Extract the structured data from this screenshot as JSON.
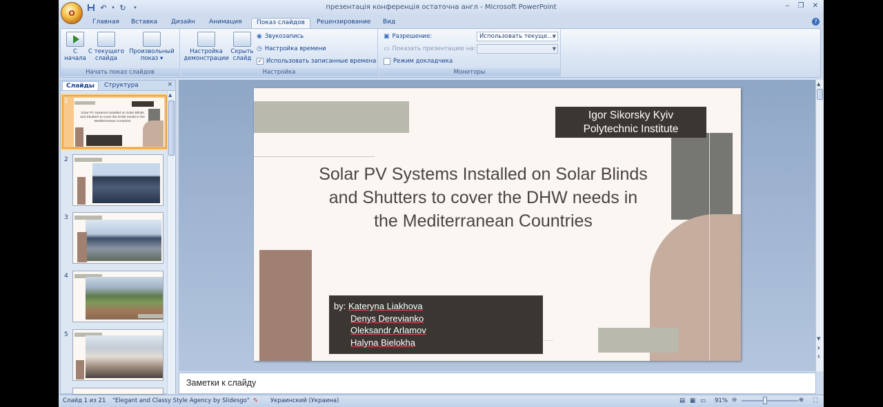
{
  "window": {
    "title": "презентація конференція остаточна  англ - Microsoft PowerPoint",
    "office_button": "O"
  },
  "tabs": [
    "Главная",
    "Вставка",
    "Дизайн",
    "Анимация",
    "Показ слайдов",
    "Рецензирование",
    "Вид"
  ],
  "ribbon": {
    "group1": {
      "label": "Начать показ слайдов",
      "from_start": [
        "С",
        "начала"
      ],
      "from_current": [
        "С текущего",
        "слайда"
      ],
      "custom": [
        "Произвольный",
        "показ ▾"
      ]
    },
    "group2": {
      "label": "Настройка",
      "setup": [
        "Настройка",
        "демонстрации"
      ],
      "hide": [
        "Скрыть",
        "слайд"
      ],
      "record_narration": "Звукозапись",
      "rehearse": "Настройка времени",
      "use_timings": "Использовать записанные времена",
      "use_timings_checked": "✓"
    },
    "group3": {
      "label": "Мониторы",
      "resolution_label": "Разрешение:",
      "resolution_value": "Использовать текуще...",
      "show_on_label": "Показать презентацию на:",
      "presenter_view": "Режим докладчика"
    }
  },
  "left_pane": {
    "tab_slides": "Слайды",
    "tab_outline": "Структура",
    "close": "×",
    "thumbs": [
      "1",
      "2",
      "3",
      "4",
      "5"
    ],
    "thumb1_text": "Solar PV Systems Installed on Solar Blinds and Shutters to cover the DHW needs in the Mediterranean Countries"
  },
  "slide": {
    "institute": [
      "Igor Sikorsky Kyiv",
      "Polytechnic Institute"
    ],
    "title": [
      "Solar PV Systems Installed on Solar Blinds",
      "and Shutters to cover the DHW needs in",
      "the Mediterranean Countries"
    ],
    "authors_prefix": "by: ",
    "authors": [
      "Kateryna Liakhova",
      "Denys Derevianko",
      "Oleksandr Arlamov",
      "Halyna Bielokha"
    ]
  },
  "notes": {
    "placeholder": "Заметки к слайду"
  },
  "status": {
    "slide_info": "Слайд 1 из 21",
    "theme": "\"Elegant and Classy Style Agency by Slidesgo\"",
    "language": "Украинский (Украина)",
    "zoom": "91%"
  },
  "colors": {
    "slide_dark": "#3c3632",
    "slide_brown": "#a08070",
    "slide_tan": "#c6ad9e",
    "slide_grey": "#b9b9ae",
    "slide_slate": "#767672",
    "selection": "#f2a23d"
  }
}
